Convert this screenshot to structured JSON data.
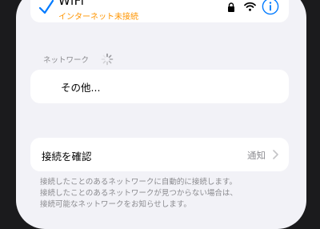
{
  "network": {
    "name": "WiFi",
    "status": "インターネット未接続"
  },
  "section": {
    "header": "ネットワーク"
  },
  "other": {
    "label": "その他..."
  },
  "ask_to_join": {
    "label": "接続を確認",
    "value": "通知"
  },
  "footer": {
    "text": "接続したことのあるネットワークに自動的に接続します。\n接続したことのあるネットワークが見つからない場合は、\n接続可能なネットワークをお知らせします。"
  },
  "colors": {
    "accent": "#007aff",
    "warning": "#ff9500",
    "secondary_text": "#8a8a8e",
    "background": "#f2f2f7"
  },
  "icons": [
    "checkmark-icon",
    "lock-icon",
    "wifi-signal-icon",
    "info-icon",
    "loading-spinner-icon",
    "chevron-right-icon"
  ]
}
